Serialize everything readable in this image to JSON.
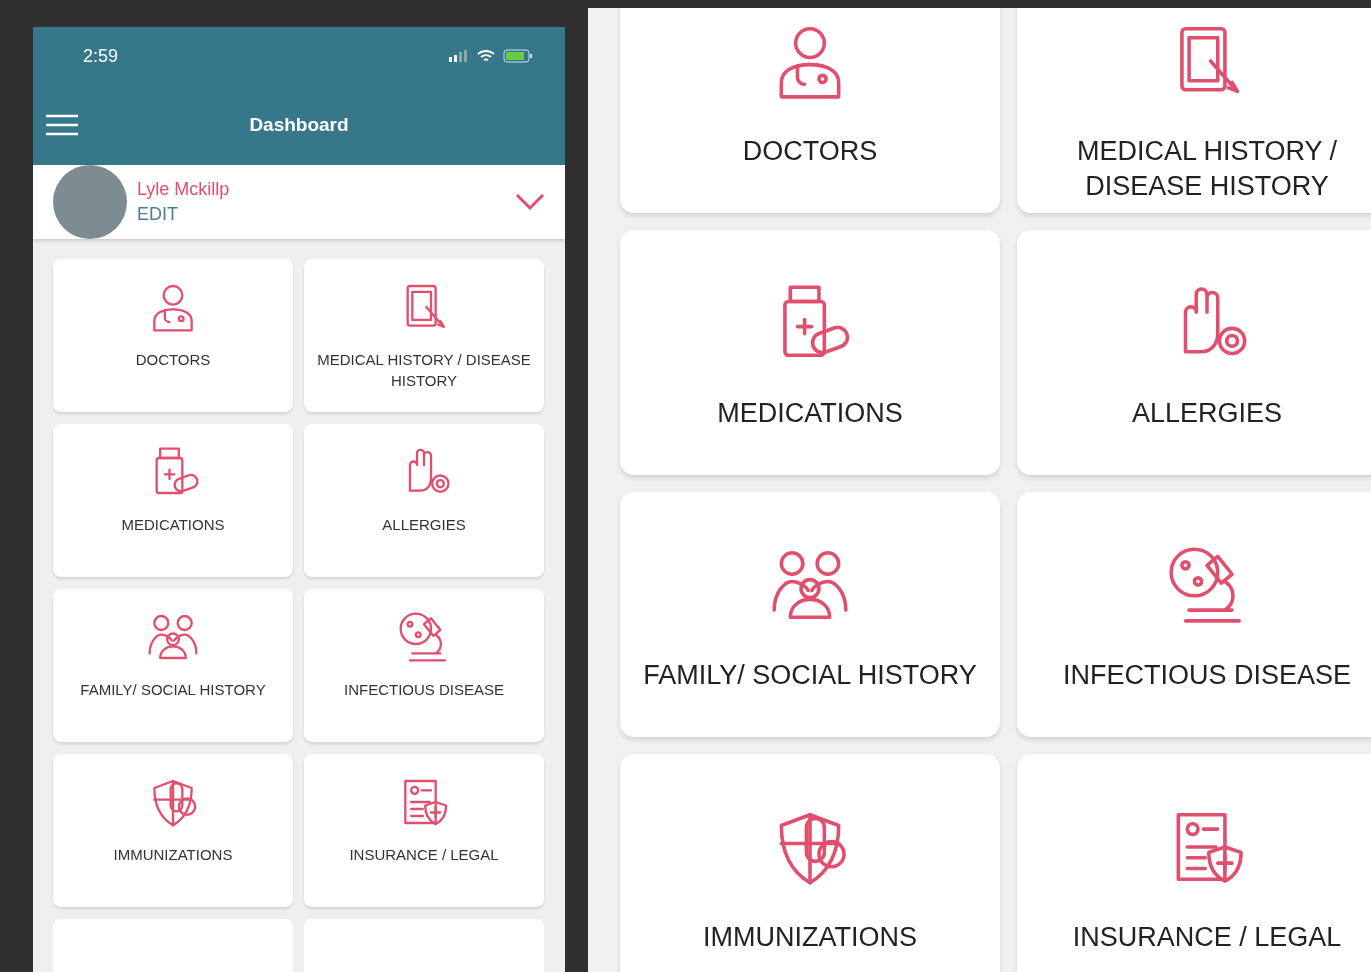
{
  "phone": {
    "status_bar": {
      "time": "2:59"
    },
    "header": {
      "title": "Dashboard"
    },
    "profile": {
      "name": "Lyle Mckillp",
      "action": "EDIT",
      "expanded": false
    },
    "tiles": [
      {
        "label": "DOCTORS"
      },
      {
        "label": "MEDICAL HISTORY / DISEASE HISTORY"
      },
      {
        "label": "MEDICATIONS"
      },
      {
        "label": "ALLERGIES"
      },
      {
        "label": "FAMILY/ SOCIAL HISTORY"
      },
      {
        "label": "INFECTIOUS DISEASE"
      },
      {
        "label": "IMMUNIZATIONS"
      },
      {
        "label": "INSURANCE / LEGAL"
      }
    ]
  },
  "zoom_view": {
    "tiles": [
      {
        "label": "DOCTORS"
      },
      {
        "label": "MEDICAL HISTORY / DISEASE HISTORY"
      },
      {
        "label": "MEDICATIONS"
      },
      {
        "label": "ALLERGIES"
      },
      {
        "label": "FAMILY/ SOCIAL HISTORY"
      },
      {
        "label": "INFECTIOUS DISEASE"
      },
      {
        "label": "IMMUNIZATIONS"
      },
      {
        "label": "INSURANCE / LEGAL"
      }
    ]
  }
}
